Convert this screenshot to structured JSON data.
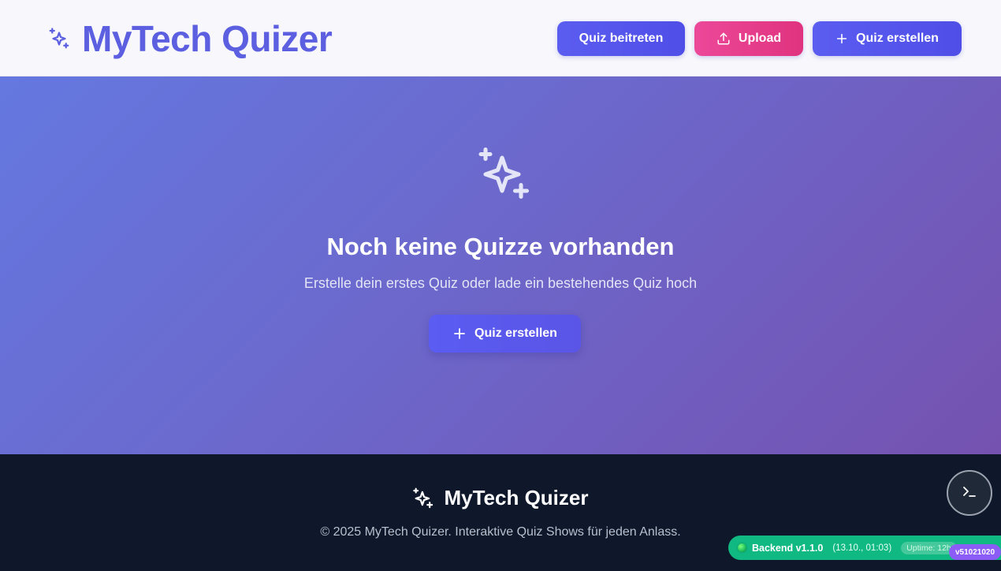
{
  "header": {
    "brand_title": "MyTech Quizer",
    "brand_icon": "sparkles-icon",
    "buttons": {
      "join": "Quiz beitreten",
      "upload": "Upload",
      "create": "Quiz erstellen"
    }
  },
  "hero": {
    "icon": "sparkles-icon",
    "title": "Noch keine Quizze vorhanden",
    "subtitle": "Erstelle dein erstes Quiz oder lade ein bestehendes Quiz hoch",
    "button": "Quiz erstellen"
  },
  "footer": {
    "brand_title": "MyTech Quizer",
    "copyright": "© 2025 MyTech Quizer. Interaktive Quiz Shows für jeden Anlass."
  },
  "status": {
    "label": "Backend v1.1.0",
    "time": "(13.10., 01:03)",
    "uptime": "Uptime: 12h",
    "version": "v51021020"
  },
  "colors": {
    "brand": "#5b5fe0",
    "upload": "#ec4899",
    "status": "#10b981",
    "version": "#8b5cf6"
  }
}
